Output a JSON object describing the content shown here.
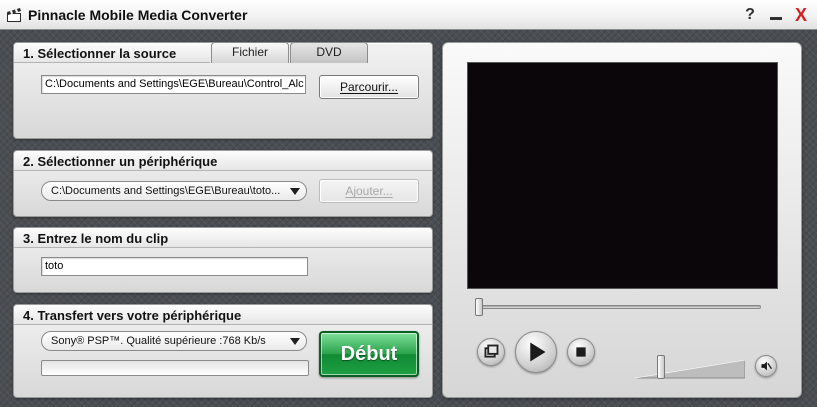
{
  "window": {
    "title": "Pinnacle Mobile Media Converter",
    "help_label": "?",
    "close_label": "X"
  },
  "source": {
    "title": "1. Sélectionner la source",
    "tabs": [
      {
        "label": "Fichier",
        "selected": true
      },
      {
        "label": "DVD",
        "selected": false
      }
    ],
    "path_value": "C:\\Documents and Settings\\EGE\\Bureau\\Control_Alc",
    "browse_label": "Parcourir..."
  },
  "device": {
    "title": "2. Sélectionner un périphérique",
    "selected": "C:\\Documents  and  Settings\\EGE\\Bureau\\toto...",
    "add_label": "Ajouter...",
    "add_enabled": false
  },
  "clip": {
    "title": "3. Entrez le nom du clip",
    "name_value": "toto"
  },
  "transfer": {
    "title": "4. Transfert vers votre périphérique",
    "format_selected": "Sony® PSP™. Qualité supérieure :768 Kb/s",
    "progress": 0,
    "start_label": "Début",
    "start_color": "#1da043"
  },
  "player": {
    "screen_color": "#0b0609",
    "seek_position": 0,
    "volume_level": 0.22,
    "icons": [
      "fullscreen-icon",
      "play-icon",
      "stop-icon",
      "volume-icon",
      "mute-icon"
    ]
  }
}
